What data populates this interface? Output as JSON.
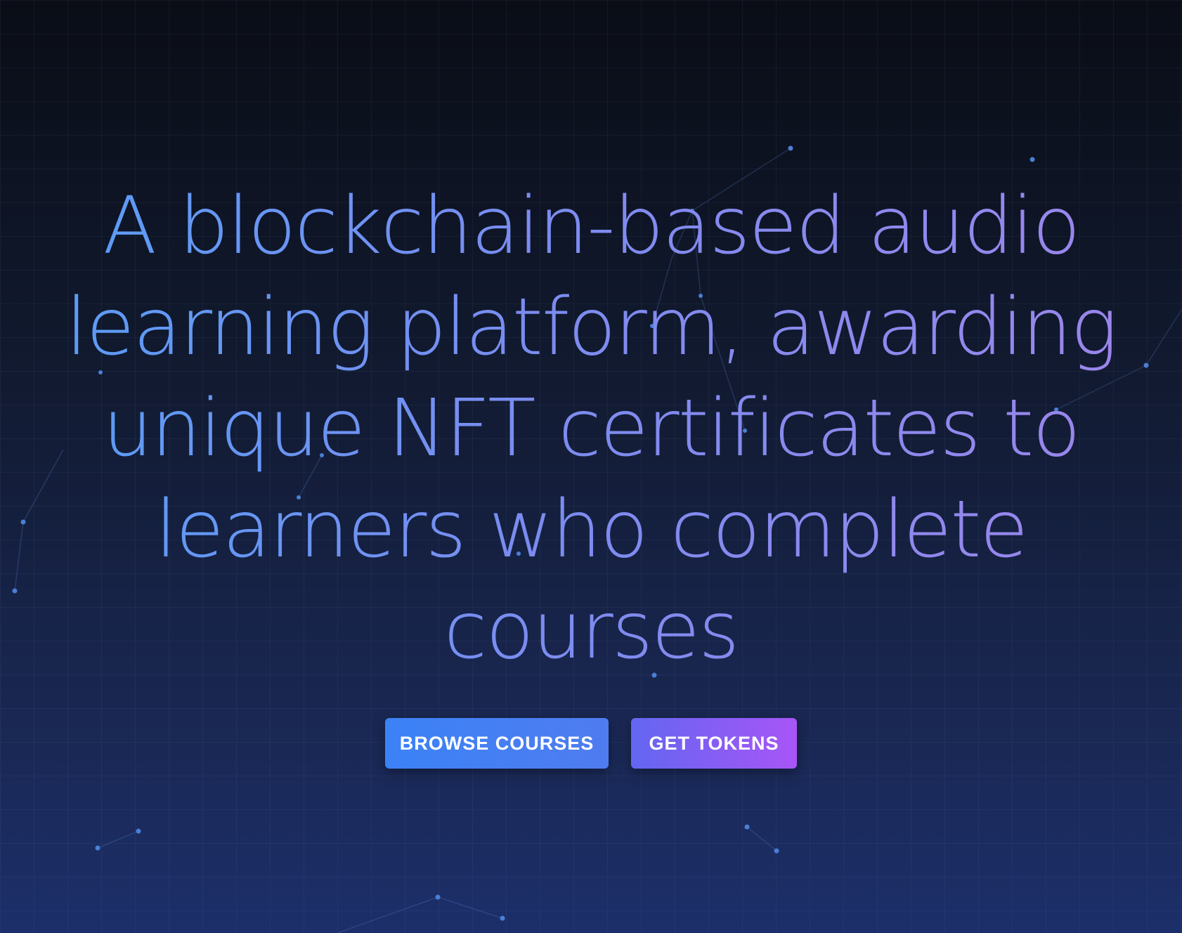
{
  "hero": {
    "headline": "A blockchain-based audio learning platform, awarding unique NFT certificates to learners who complete courses",
    "buttons": {
      "browse_label": "BROWSE COURSES",
      "tokens_label": "GET TOKENS"
    }
  },
  "colors": {
    "background_top": "#0a0d16",
    "background_bottom": "#1c2f6a",
    "headline_gradient_start": "#5b9cf6",
    "headline_gradient_end": "#9a86ec",
    "browse_button": "#3b82f6",
    "tokens_button_start": "#6366f1",
    "tokens_button_end": "#a855f7",
    "particle": "#4a7fd4"
  }
}
